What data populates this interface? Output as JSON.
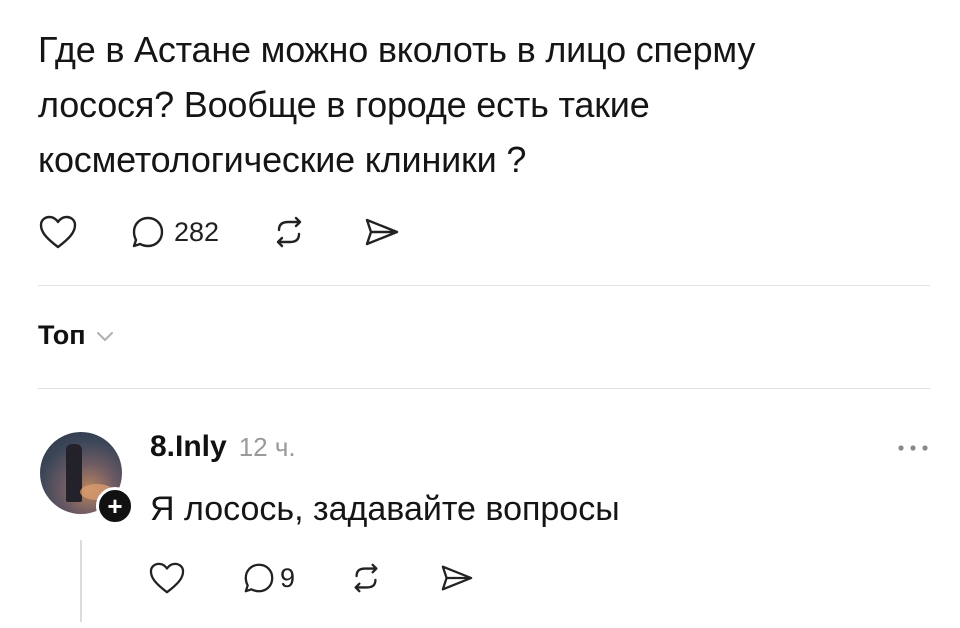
{
  "post": {
    "lines": [
      "Где в Астане можно вколоть в лицо сперму",
      "лосося? Вообще в городе есть такие",
      "косметологические клиники ?"
    ],
    "actions": {
      "like_icon": "heart-icon",
      "reply_icon": "comment-icon",
      "reply_count": "282",
      "repost_icon": "repost-icon",
      "share_icon": "send-icon"
    }
  },
  "sort": {
    "label": "Топ",
    "icon": "chevron-down-icon"
  },
  "reply": {
    "username": "8.Inly",
    "time": "12 ч.",
    "text": "Я лосось, задавайте вопросы",
    "follow_icon": "plus-icon",
    "more_icon": "more-icon",
    "reply_count": "9"
  }
}
